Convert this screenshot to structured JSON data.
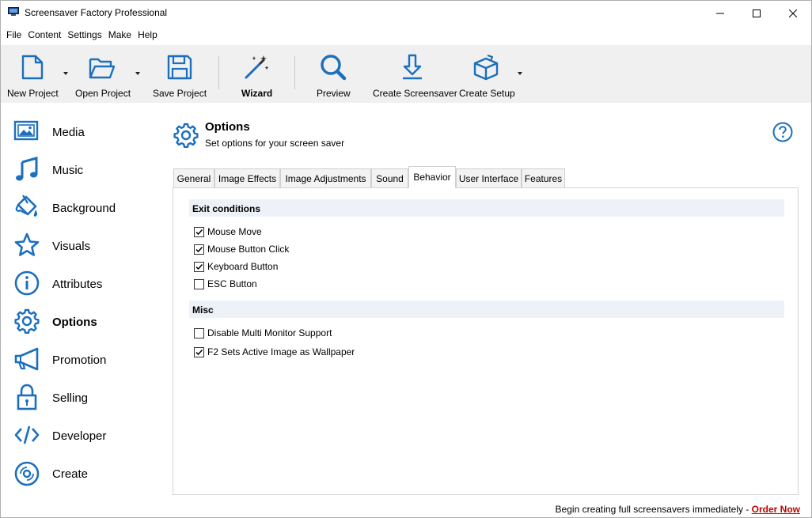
{
  "window": {
    "title": "Screensaver Factory Professional"
  },
  "menu": [
    "File",
    "Content",
    "Settings",
    "Make",
    "Help"
  ],
  "toolbar": {
    "new_project": "New Project",
    "open_project": "Open Project",
    "save_project": "Save Project",
    "wizard": "Wizard",
    "preview": "Preview",
    "create_screensaver": "Create Screensaver",
    "create_setup": "Create Setup"
  },
  "sidebar": {
    "items": [
      {
        "label": "Media",
        "icon": "media-icon"
      },
      {
        "label": "Music",
        "icon": "music-note-icon"
      },
      {
        "label": "Background",
        "icon": "paint-bucket-icon"
      },
      {
        "label": "Visuals",
        "icon": "star-icon"
      },
      {
        "label": "Attributes",
        "icon": "info-icon"
      },
      {
        "label": "Options",
        "icon": "gear-icon",
        "active": true
      },
      {
        "label": "Promotion",
        "icon": "megaphone-icon"
      },
      {
        "label": "Selling",
        "icon": "lock-icon"
      },
      {
        "label": "Developer",
        "icon": "code-icon"
      },
      {
        "label": "Create",
        "icon": "disc-icon"
      }
    ]
  },
  "header": {
    "title": "Options",
    "subtitle": "Set options for your screen saver"
  },
  "tabs": [
    "General",
    "Image Effects",
    "Image Adjustments",
    "Sound",
    "Behavior",
    "User Interface",
    "Features"
  ],
  "active_tab": "Behavior",
  "behavior": {
    "exit_conditions": {
      "heading": "Exit conditions",
      "options": [
        {
          "label": "Mouse Move",
          "checked": true
        },
        {
          "label": "Mouse Button Click",
          "checked": true
        },
        {
          "label": "Keyboard Button",
          "checked": true
        },
        {
          "label": "ESC Button",
          "checked": false
        }
      ]
    },
    "misc": {
      "heading": "Misc",
      "options": [
        {
          "label": "Disable Multi Monitor Support",
          "checked": false
        },
        {
          "label": "F2 Sets Active Image as Wallpaper",
          "checked": true
        }
      ]
    }
  },
  "footer": {
    "text": "Begin creating full screensavers immediately - ",
    "link": "Order Now"
  },
  "colors": {
    "accent": "#1c6fbd",
    "toolbar_bg": "#f0f0f0",
    "section_bg": "#edf2f9",
    "link": "#c00000"
  }
}
